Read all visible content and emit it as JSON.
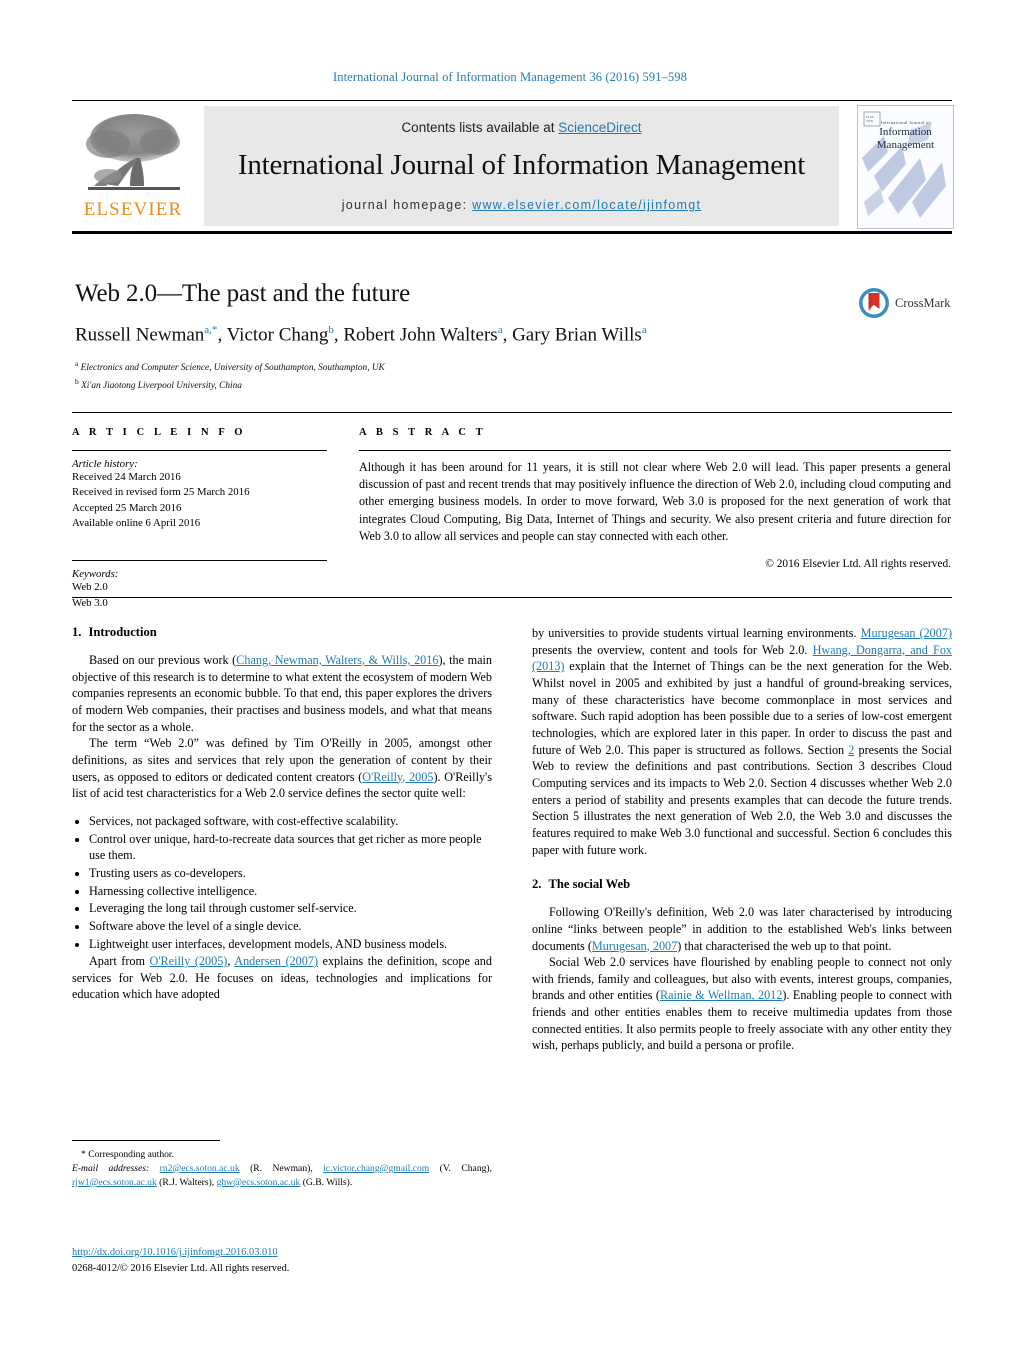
{
  "running_head": "International Journal of Information Management 36 (2016) 591–598",
  "masthead": {
    "contents_prefix": "Contents lists available at ",
    "contents_link": "ScienceDirect",
    "journal_title": "International Journal of Information Management",
    "homepage_prefix": "journal homepage: ",
    "homepage_url": "www.elsevier.com/locate/ijinfomgt",
    "publisher_logo_text": "ELSEVIER",
    "cover": {
      "superline": "International Journal of",
      "line1": "Information",
      "line2": "Management",
      "publisher": "Elsevier"
    }
  },
  "crossmark": {
    "label": "CrossMark"
  },
  "title_block": {
    "title": "Web 2.0—The past and the future",
    "authors_html": "Russell Newman<sup>a,*</sup>, Victor Chang<sup>b</sup>, Robert John Walters<sup>a</sup>, Gary Brian Wills<sup>a</sup>",
    "authors_plain": "Russell Newman a,*, Victor Chang b, Robert John Walters a, Gary Brian Wills a",
    "affiliation_a": "Electronics and Computer Science, University of Southampton, Southampton, UK",
    "affiliation_b": "Xi'an Jiaotong Liverpool University, China"
  },
  "article_info": {
    "label": "A R T I C L E    I N F O",
    "history_heading": "Article history:",
    "history": [
      "Received 24 March 2016",
      "Received in revised form 25 March 2016",
      "Accepted 25 March 2016",
      "Available online 6 April 2016"
    ],
    "keywords_heading": "Keywords:",
    "keywords": [
      "Web 2.0",
      "Web 3.0"
    ]
  },
  "abstract": {
    "label": "A B S T R A C T",
    "text": "Although it has been around for 11 years, it is still not clear where Web 2.0 will lead. This paper presents a general discussion of past and recent trends that may positively influence the direction of Web 2.0, including cloud computing and other emerging business models. In order to move forward, Web 3.0 is proposed for the next generation of work that integrates Cloud Computing, Big Data, Internet of Things and security. We also present criteria and future direction for Web 3.0 to allow all services and people can stay connected with each other.",
    "copyright": "© 2016 Elsevier Ltd. All rights reserved."
  },
  "sections": {
    "intro": {
      "number": "1.",
      "heading": "Introduction",
      "p1_a": "Based on our previous work (",
      "p1_ref": "Chang, Newman, Walters, & Wills, 2016",
      "p1_b": "), the main objective of this research is to determine to what extent the ecosystem of modern Web companies represents an economic bubble. To that end, this paper explores the drivers of modern Web companies, their practises and business models, and what that means for the sector as a whole.",
      "p2_a": "The term “Web 2.0” was defined by Tim O'Reilly in 2005, amongst other definitions, as sites and services that rely upon the generation of content by their users, as opposed to editors or dedicated content creators (",
      "p2_ref": "O'Reilly, 2005",
      "p2_b": "). O'Reilly's list of acid test characteristics for a Web 2.0 service defines the sector quite well:",
      "bullets": [
        "Services, not packaged software, with cost-effective scalability.",
        "Control over unique, hard-to-recreate data sources that get richer as more people use them.",
        "Trusting users as co-developers.",
        "Harnessing collective intelligence.",
        "Leveraging the long tail through customer self-service.",
        "Software above the level of a single device.",
        "Lightweight user interfaces, development models, AND business models."
      ],
      "p3_a": "Apart from ",
      "p3_ref1": "O'Reilly (2005)",
      "p3_mid": ", ",
      "p3_ref2": "Andersen (2007)",
      "p3_b": " explains the definition, scope and services for Web 2.0. He focuses on ideas, technologies and implications for education which have adopted",
      "rc_a": "by universities to provide students virtual learning environments. ",
      "rc_ref1": "Murugesan (2007)",
      "rc_b": " presents the overview, content and tools for Web 2.0. ",
      "rc_ref2": "Hwang, Dongarra, and Fox (2013)",
      "rc_c": " explain that the Internet of Things can be the next generation for the Web. Whilst novel in 2005 and exhibited by just a handful of ground-breaking services, many of these characteristics have become commonplace in most services and software. Such rapid adoption has been possible due to a series of low-cost emergent technologies, which are explored later in this paper. In order to discuss the past and future of Web 2.0. This paper is structured as follows. Section ",
      "rc_seclink": "2",
      "rc_d": " presents the Social Web to review the definitions and past contributions. Section 3 describes Cloud Computing services and its impacts to Web 2.0. Section 4 discusses whether Web 2.0 enters a period of stability and presents examples that can decode the future trends. Section 5 illustrates the next generation of Web 2.0, the Web 3.0 and discusses the features required to make Web 3.0 functional and successful. Section 6 concludes this paper with future work."
    },
    "social_web": {
      "number": "2.",
      "heading": "The social Web",
      "p1_a": "Following O'Reilly's definition, Web 2.0 was later characterised by introducing online “links between people” in addition to the established Web's links between documents (",
      "p1_ref": "Murugesan, 2007",
      "p1_b": ") that characterised the web up to that point.",
      "p2_a": "Social Web 2.0 services have flourished by enabling people to connect not only with friends, family and colleagues, but also with events, interest groups, companies, brands and other entities (",
      "p2_ref": "Rainie & Wellman, 2012",
      "p2_b": "). Enabling people to connect with friends and other entities enables them to receive multimedia updates from those connected entities. It also permits people to freely associate with any other entity they wish, perhaps publicly, and build a persona or profile."
    }
  },
  "footnotes": {
    "corresponding": "* Corresponding author.",
    "email_label": "E-mail addresses:",
    "emails": [
      {
        "address": "rn2@ecs.soton.ac.uk",
        "owner": "(R. Newman)"
      },
      {
        "address": "ic.victor.chang@gmail.com",
        "owner": "(V. Chang)"
      },
      {
        "address": "rjw1@ecs.soton.ac.uk",
        "owner": "(R.J. Walters)"
      },
      {
        "address": "ghw@ecs.soton.ac.uk",
        "owner": "(G.B. Wills)"
      }
    ],
    "doi_url": "http://dx.doi.org/10.1016/j.ijinfomgt.2016.03.010",
    "issn_line": "0268-4012/© 2016 Elsevier Ltd. All rights reserved."
  },
  "colors": {
    "link": "#1f7bb6",
    "elsevier_orange": "#f08a1d",
    "band_gray": "#e8e8e8"
  }
}
